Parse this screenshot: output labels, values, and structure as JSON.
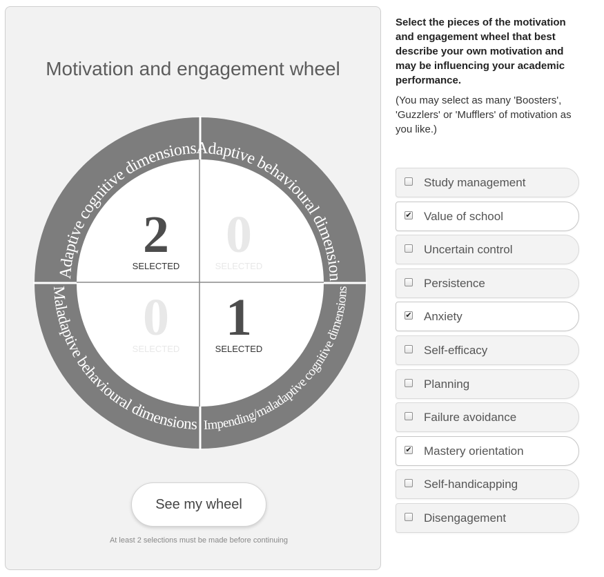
{
  "wheel": {
    "title": "Motivation and engagement wheel",
    "quadrants": [
      {
        "label": "Adaptive cognitive dimensions",
        "count": "2",
        "selected_text": "SELECTED",
        "active": true
      },
      {
        "label": "Adaptive behavioural dimensions",
        "count": "0",
        "selected_text": "SELECTED",
        "active": false
      },
      {
        "label": "Maladaptive behavioural dimensions",
        "count": "0",
        "selected_text": "SELECTED",
        "active": false
      },
      {
        "label": "Impending/maladaptive cognitive dimensions",
        "count": "1",
        "selected_text": "SELECTED",
        "active": true
      }
    ],
    "colors": {
      "ring": "#7d7d7d",
      "ring_text": "#ffffff",
      "active_number": "#4d4d4d",
      "inactive_number": "#e8e8e8"
    }
  },
  "button": {
    "label": "See my wheel"
  },
  "note": "At least 2 selections must be made before continuing",
  "instructions": {
    "main": "Select the pieces of the motivation and engagement wheel that best describe your own motivation and may be influencing your academic performance.",
    "sub": "(You may select as many 'Boosters', 'Guzzlers' or 'Mufflers' of motivation as you like.)"
  },
  "options": [
    {
      "label": "Study management",
      "checked": false
    },
    {
      "label": "Value of school",
      "checked": true
    },
    {
      "label": "Uncertain control",
      "checked": false
    },
    {
      "label": "Persistence",
      "checked": false
    },
    {
      "label": "Anxiety",
      "checked": true
    },
    {
      "label": "Self-efficacy",
      "checked": false
    },
    {
      "label": "Planning",
      "checked": false
    },
    {
      "label": "Failure avoidance",
      "checked": false
    },
    {
      "label": "Mastery orientation",
      "checked": true
    },
    {
      "label": "Self-handicapping",
      "checked": false
    },
    {
      "label": "Disengagement",
      "checked": false
    }
  ]
}
